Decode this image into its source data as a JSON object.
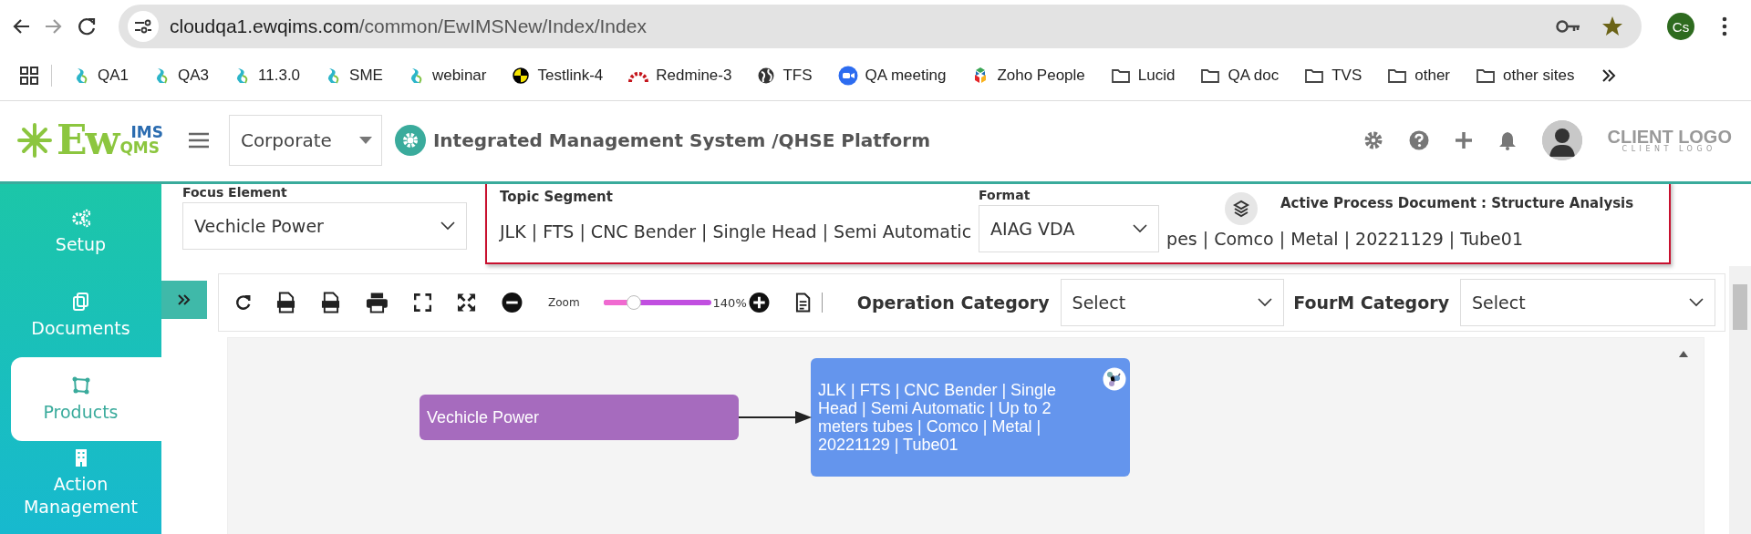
{
  "browser": {
    "url_host": "cloudqa1.ewqims.com",
    "url_path": "/common/EwIMSNew/Index/Index",
    "profile": "Cs",
    "bookmarks": [
      {
        "label": "QA1",
        "kind": "ewqims"
      },
      {
        "label": "QA3",
        "kind": "ewqims"
      },
      {
        "label": "11.3.0",
        "kind": "ewqims"
      },
      {
        "label": "SME",
        "kind": "ewqims"
      },
      {
        "label": "webinar",
        "kind": "ewqims"
      },
      {
        "label": "Testlink-4",
        "kind": "testlink"
      },
      {
        "label": "Redmine-3",
        "kind": "redmine"
      },
      {
        "label": "TFS",
        "kind": "globe"
      },
      {
        "label": "QA meeting",
        "kind": "zoom"
      },
      {
        "label": "Zoho People",
        "kind": "zoho"
      },
      {
        "label": "Lucid",
        "kind": "folder"
      },
      {
        "label": "QA doc",
        "kind": "folder"
      },
      {
        "label": "TVS",
        "kind": "folder"
      },
      {
        "label": "other",
        "kind": "folder"
      },
      {
        "label": "other sites",
        "kind": "folder"
      }
    ]
  },
  "header": {
    "logo_main": "Ew",
    "logo_top": "IMS",
    "logo_bottom": "QMS",
    "site": "Corporate",
    "title": "Integrated Management System /QHSE Platform",
    "client_logo": "CLIENT LOGO",
    "client_logo_sub": "CLIENT LOGO"
  },
  "sidebar": {
    "items": [
      {
        "label": "Setup",
        "selected": false
      },
      {
        "label": "Documents",
        "selected": false
      },
      {
        "label": "Products",
        "selected": true
      },
      {
        "label": "Action Management",
        "selected": false
      }
    ]
  },
  "form": {
    "focus_label": "Focus Element",
    "focus_value": "Vechicle Power",
    "topic_label": "Topic Segment",
    "topic_text_left": "JLK | FTS | CNC Bender | Single Head | Semi Automatic",
    "topic_text_right": "pes | Comco | Metal | 20221129 | Tube01",
    "format_label": "Format",
    "format_value": "AIAG VDA",
    "active_document": "Active Process Document : Structure Analysis"
  },
  "toolbar": {
    "zoom_label": "Zoom",
    "zoom": {
      "level": 0.3
    },
    "zoom_reading": "140%",
    "operation_label": "Operation Category",
    "operation_value": "Select",
    "fourm_label": "FourM Category",
    "fourm_value": "Select"
  },
  "diagram": {
    "nodes": [
      {
        "label": "Vechicle Power",
        "color": "#a66bbe",
        "kind": "focus"
      },
      {
        "label": "JLK | FTS | CNC Bender | Single Head | Semi Automatic | Up to 2 meters tubes | Comco | Metal | 20221129 | Tube01",
        "color": "#6495ed",
        "kind": "topic"
      }
    ]
  }
}
